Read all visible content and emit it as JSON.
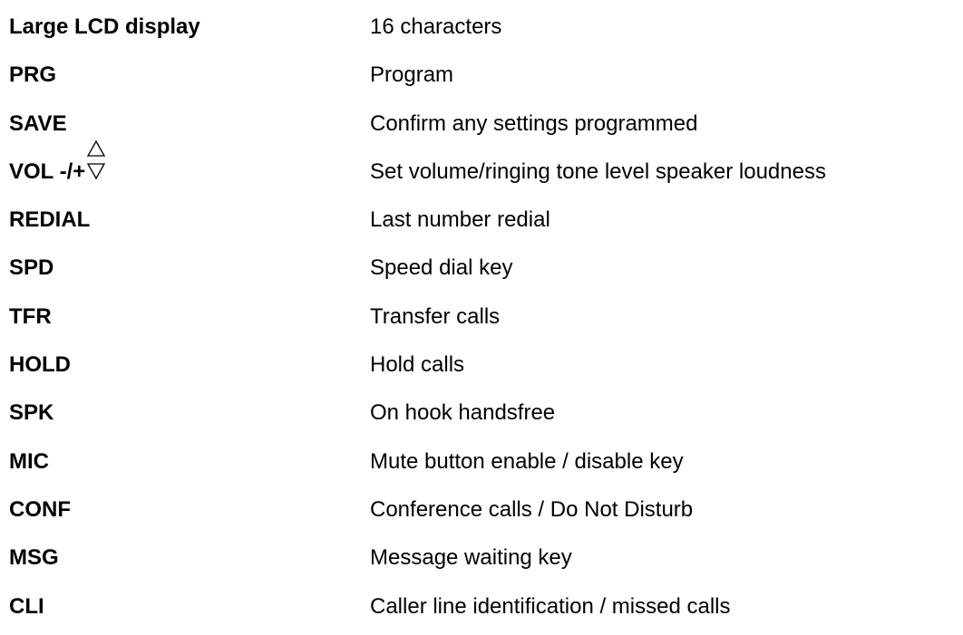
{
  "rows": [
    {
      "term": "Large LCD display",
      "desc": "16 characters"
    },
    {
      "term": "PRG",
      "desc": "Program"
    },
    {
      "term": "SAVE",
      "desc": "Confirm any settings programmed"
    },
    {
      "term": "VOL -/+",
      "desc": "Set volume/ringing tone level speaker loudness",
      "icons": [
        "up-triangle-icon",
        "down-triangle-icon"
      ]
    },
    {
      "term": "REDIAL",
      "desc": "Last number redial"
    },
    {
      "term": "SPD",
      "desc": "Speed dial key"
    },
    {
      "term": "TFR",
      "desc": "Transfer calls"
    },
    {
      "term": "HOLD",
      "desc": "Hold calls"
    },
    {
      "term": "SPK",
      "desc": "On hook handsfree"
    },
    {
      "term": "MIC",
      "desc": "Mute button enable / disable key"
    },
    {
      "term": "CONF",
      "desc": "Conference calls / Do Not Disturb"
    },
    {
      "term": "MSG",
      "desc": "Message waiting key"
    },
    {
      "term": "CLI",
      "desc": "Caller line identification / missed calls"
    }
  ]
}
